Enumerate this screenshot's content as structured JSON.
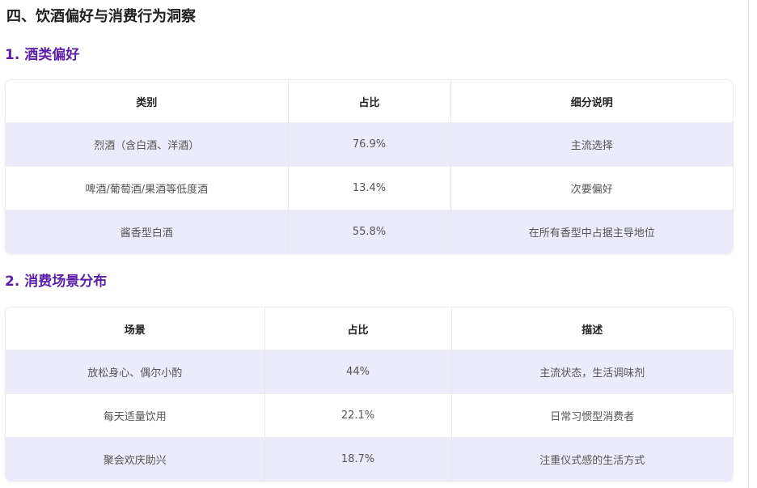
{
  "doc_title": "四、饮酒偏好与消费行为洞察",
  "sections": [
    {
      "title": "1. 酒类偏好",
      "headers": [
        "类别",
        "占比",
        "细分说明"
      ],
      "rows": [
        [
          "烈酒（含白酒、洋酒）",
          "76.9%",
          "主流选择"
        ],
        [
          "啤酒/葡萄酒/果酒等低度酒",
          "13.4%",
          "次要偏好"
        ],
        [
          "酱香型白酒",
          "55.8%",
          "在所有香型中占据主导地位"
        ]
      ]
    },
    {
      "title": "2. 消费场景分布",
      "headers": [
        "场景",
        "占比",
        "描述"
      ],
      "rows": [
        [
          "放松身心、偶尔小酌",
          "44%",
          "主流状态，生活调味剂"
        ],
        [
          "每天适量饮用",
          "22.1%",
          "日常习惯型消费者"
        ],
        [
          "聚会欢庆助兴",
          "18.7%",
          "注重仪式感的生活方式"
        ]
      ]
    }
  ],
  "colors": {
    "section_title": "#5b1fa6",
    "row_highlight": "#ecebfb"
  }
}
